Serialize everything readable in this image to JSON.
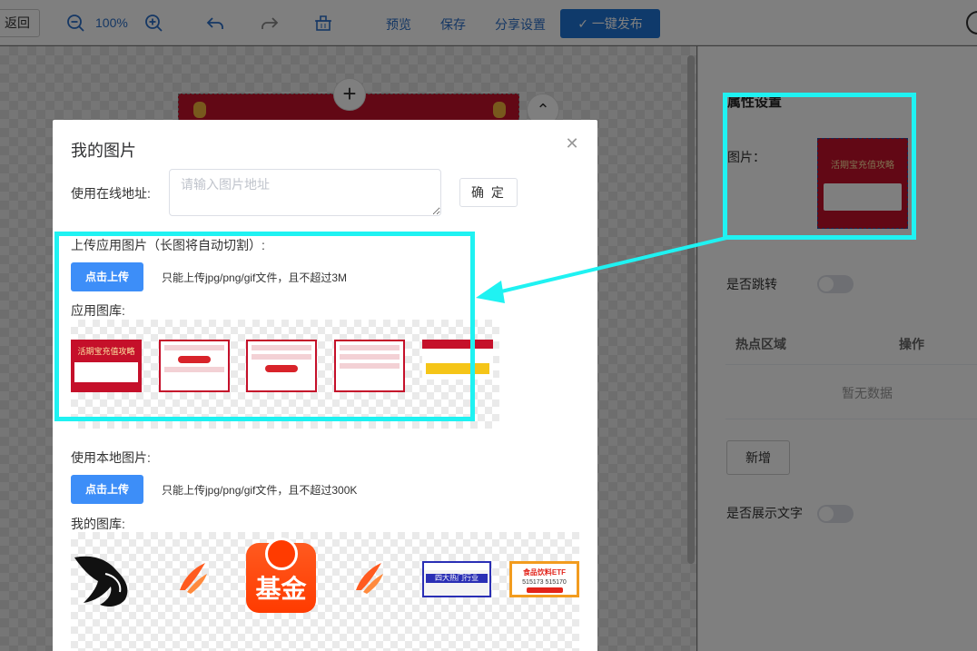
{
  "toolbar": {
    "back_label": "返回",
    "zoom": "100%",
    "preview_label": "预览",
    "save_label": "保存",
    "share_label": "分享设置",
    "publish_label": "一键发布",
    "icons": [
      "zoom-out-icon",
      "zoom-in-icon",
      "undo-icon",
      "redo-icon",
      "clear-icon",
      "check-icon",
      "user-avatar-icon"
    ]
  },
  "properties": {
    "title": "属性设置",
    "image_label": "图片：",
    "image_preview_title": "活期宝充值攻略",
    "jump_label": "是否跳转",
    "table": {
      "columns": [
        "热点区域",
        "操作"
      ],
      "empty_text": "暂无数据"
    },
    "add_label": "新增",
    "show_text_label": "是否展示文字"
  },
  "dialog": {
    "title": "我的图片",
    "online_url_label": "使用在线地址:",
    "url_placeholder": "请输入图片地址",
    "url_value": "",
    "confirm_label": "确 定",
    "upload_app_label": "上传应用图片（长图将自动切割）:",
    "upload_button": "点击上传",
    "upload_app_hint": "只能上传jpg/png/gif文件，且不超过3M",
    "app_gallery_label": "应用图库:",
    "app_gallery_thumb_title": "活期宝充值攻略",
    "local_label": "使用本地图片:",
    "local_hint": "只能上传jpg/png/gif文件，且不超过300K",
    "my_gallery_label": "我的图库:",
    "fund_app_text": "基金",
    "banner1_text": "四大热门行业",
    "banner2_title": "食品饮料ETF",
    "banner2_codes": "515173 515170",
    "close_icon": "close-icon"
  },
  "annotation": {
    "color": "#1ff2f2"
  }
}
